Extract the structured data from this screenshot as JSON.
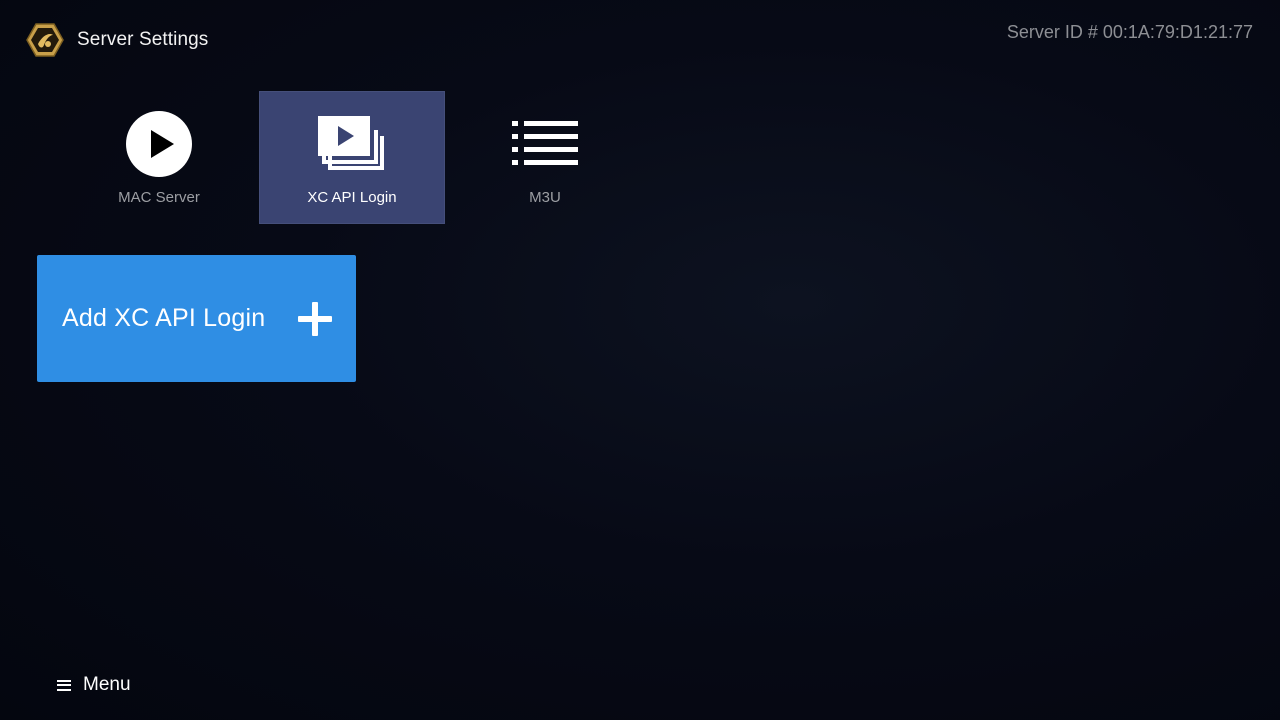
{
  "header": {
    "title": "Server Settings",
    "server_id": "Server ID # 00:1A:79:D1:21:77"
  },
  "tabs": [
    {
      "label": "MAC Server",
      "icon": "play-circle-icon",
      "active": false
    },
    {
      "label": "XC API Login",
      "icon": "video-stack-icon",
      "active": true
    },
    {
      "label": "M3U",
      "icon": "list-icon",
      "active": false
    }
  ],
  "add_card": {
    "label": "Add XC API Login",
    "icon": "plus-icon"
  },
  "footer": {
    "menu_label": "Menu",
    "icon": "hamburger-icon"
  },
  "colors": {
    "background": "#050713",
    "active_tab": "#3a4472",
    "accent_blue": "#2f8ee4",
    "logo_gold": "#c9a04a"
  }
}
